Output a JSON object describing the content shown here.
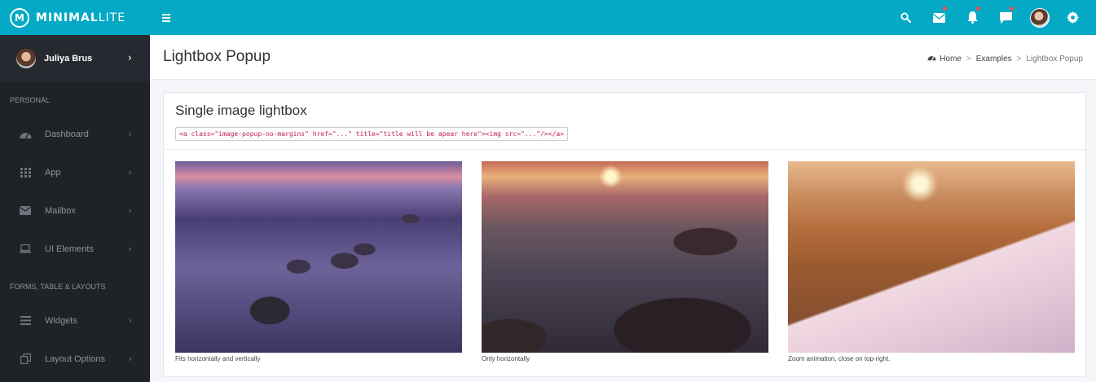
{
  "brand": {
    "logo_glyph": "M",
    "name_bold": "MINIMAL",
    "name_light": "LITE"
  },
  "header": {
    "icons": [
      "search-icon",
      "mail-icon",
      "bell-icon",
      "chat-icon",
      "avatar",
      "gear-icon"
    ],
    "accent": "#03a9c5"
  },
  "sidebar": {
    "user": {
      "name": "Juliya Brus",
      "chevron": "›"
    },
    "sections": [
      {
        "label": "PERSONAL"
      },
      {
        "label": "FORMS, TABLE & LAYOUTS"
      }
    ],
    "items": [
      {
        "label": "Dashboard",
        "icon": "dashboard-icon"
      },
      {
        "label": "App",
        "icon": "grid-icon"
      },
      {
        "label": "Mailbox",
        "icon": "envelope-icon"
      },
      {
        "label": "UI Elements",
        "icon": "laptop-icon"
      },
      {
        "label": "Widgets",
        "icon": "list-icon"
      },
      {
        "label": "Layout Options",
        "icon": "copy-icon"
      }
    ],
    "chevron": "›"
  },
  "content": {
    "title": "Lightbox Popup",
    "breadcrumb": [
      {
        "label": "Home"
      },
      {
        "label": "Examples"
      },
      {
        "label": "Lightbox Popup"
      }
    ],
    "breadcrumb_sep": ">"
  },
  "box": {
    "title": "Single image lightbox",
    "code": "<a class=\"image-popup-no-margins\" href=\"...\" title=\"title will be apear here\"><img src=\"...\"/></a>",
    "images": [
      {
        "caption": "Fits horizontally and vertically"
      },
      {
        "caption": "Only horizontally"
      },
      {
        "caption": "Zoom animation, close on top-right."
      }
    ]
  }
}
